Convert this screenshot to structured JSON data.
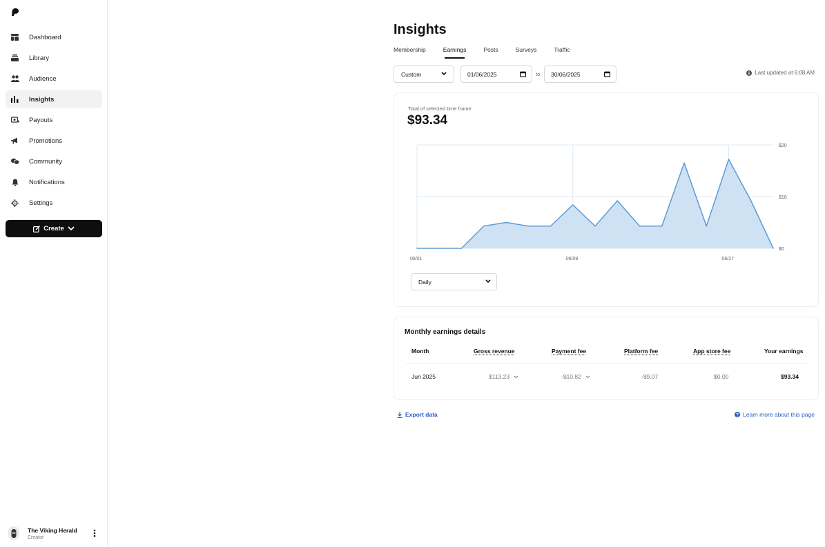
{
  "sidebar": {
    "logo": "patreon-logo-icon",
    "items": [
      {
        "label": "Dashboard",
        "icon": "dashboard-icon"
      },
      {
        "label": "Library",
        "icon": "library-icon"
      },
      {
        "label": "Audience",
        "icon": "audience-icon"
      },
      {
        "label": "Insights",
        "icon": "insights-icon",
        "active": true
      },
      {
        "label": "Payouts",
        "icon": "payouts-icon"
      },
      {
        "label": "Promotions",
        "icon": "megaphone-icon"
      },
      {
        "label": "Community",
        "icon": "community-icon"
      },
      {
        "label": "Notifications",
        "icon": "bell-icon"
      },
      {
        "label": "Settings",
        "icon": "gear-icon"
      }
    ],
    "create_label": "Create",
    "profile": {
      "name": "The Viking Herald",
      "role": "Creator"
    }
  },
  "header": {
    "title": "Insights",
    "tabs": [
      "Membership",
      "Earnings",
      "Posts",
      "Surveys",
      "Traffic"
    ],
    "active_tab": "Earnings"
  },
  "controls": {
    "range_select": "Custom",
    "start_date": "01/06/2025",
    "to_label": "to",
    "end_date": "30/06/2025",
    "last_updated": "Last updated at 6:08 AM"
  },
  "summary": {
    "total_label": "Total of selected time frame",
    "total_value": "$93.34",
    "granularity": "Daily"
  },
  "chart_data": {
    "type": "area",
    "x_ticks": [
      "06/01",
      "06/09",
      "06/27"
    ],
    "y_ticks": [
      "$0",
      "$10",
      "$20"
    ],
    "ylim": [
      0,
      20
    ],
    "grid": true,
    "values": [
      0,
      0,
      0,
      4.3,
      5,
      4.3,
      4.3,
      8.4,
      4.3,
      9.2,
      4.3,
      4.3,
      16.5,
      4.3,
      17.2,
      9.2,
      0
    ],
    "colors": {
      "line": "#5b9bd5",
      "fill": "#cfe2f3",
      "grid": "#dde8f4"
    }
  },
  "table": {
    "title": "Monthly earnings details",
    "headers": [
      "Month",
      "Gross revenue",
      "Payment fee",
      "Platform fee",
      "App store fee",
      "Your earnings"
    ],
    "rows": [
      {
        "month": "Jun 2025",
        "gross": "$113.23",
        "payment": "-$10.82",
        "platform": "-$9.07",
        "appstore": "$0.00",
        "earnings": "$93.34"
      }
    ]
  },
  "footer": {
    "export_label": "Export data",
    "learn_label": "Learn more about this page"
  }
}
